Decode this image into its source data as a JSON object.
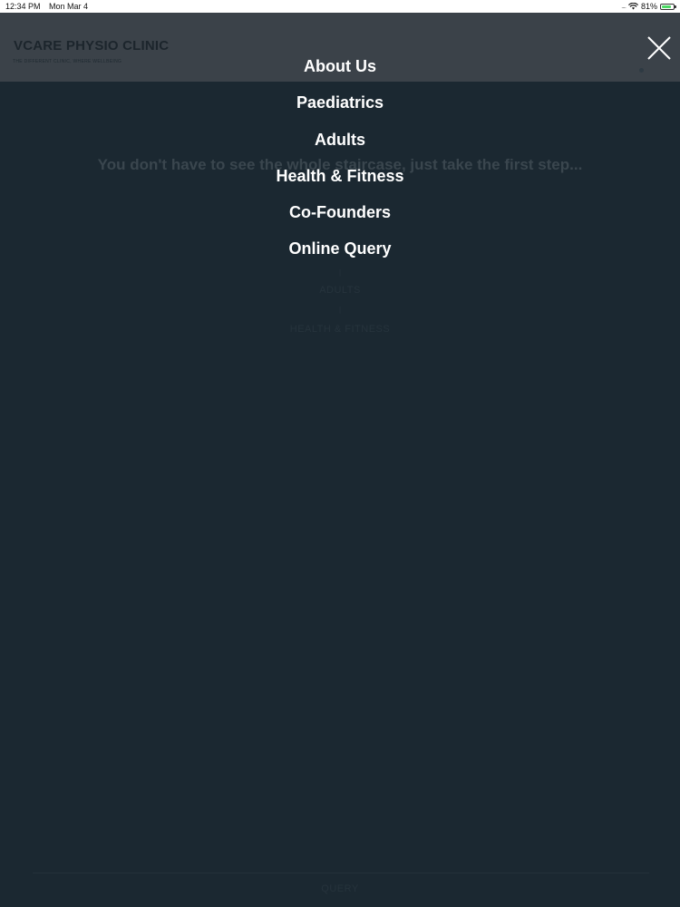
{
  "status_bar": {
    "time": "12:34 PM",
    "date": "Mon Mar 4",
    "signal": "....",
    "battery_percent": "81%",
    "battery_level": 0.81,
    "icons": [
      "wifi-icon",
      "battery-icon"
    ]
  },
  "site": {
    "brand": "VCARE PHYSIO CLINIC",
    "tagline": "THE DIFFERENT CLINIC, WHERE WELLBEING",
    "hero_quote": "You don't have to see the whole staircase, just take the first step...",
    "bg_nav": [
      "ADULTS",
      "HEALTH & FITNESS"
    ],
    "footer": "QUERY"
  },
  "menu": {
    "close_icon": "close-icon",
    "items": [
      "About Us",
      "Paediatrics",
      "Adults",
      "Health & Fitness",
      "Co-Founders",
      "Online Query"
    ]
  },
  "colors": {
    "overlay": "#1b2831",
    "menu_text": "#ffffff",
    "header_dimmed": "#3b4249"
  }
}
